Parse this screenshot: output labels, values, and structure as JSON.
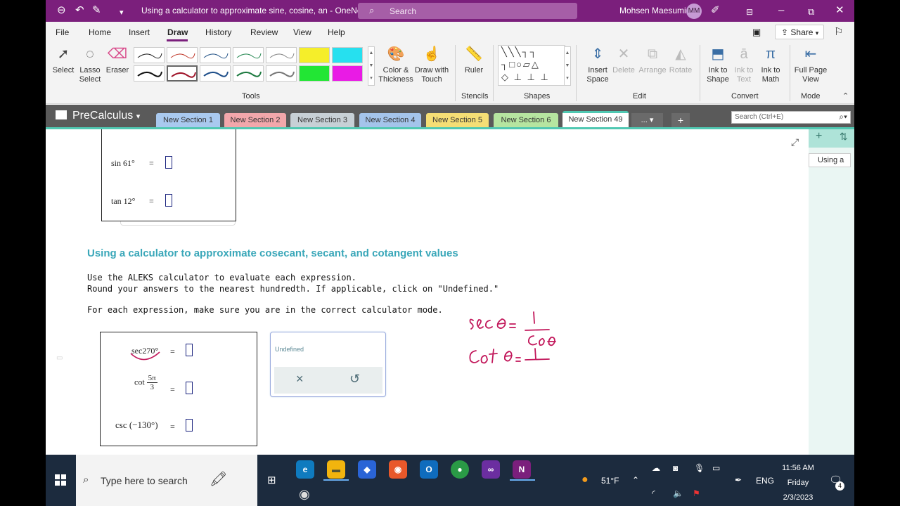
{
  "window": {
    "title": "Using a calculator to approximate sine, cosine, an  -  OneNote",
    "search_placeholder": "Search",
    "user_name": "Mohsen Maesumi",
    "user_initials": "MM"
  },
  "menu": {
    "tabs": [
      "File",
      "Home",
      "Insert",
      "Draw",
      "History",
      "Review",
      "View",
      "Help"
    ],
    "active": "Draw",
    "share_label": "Share"
  },
  "ribbon": {
    "select_label": "Select",
    "lasso_label": "Lasso Select",
    "eraser_label": "Eraser",
    "color_label": "Color & Thickness",
    "draw_touch_label": "Draw with Touch",
    "ruler_label": "Ruler",
    "insert_space_label": "Insert Space",
    "delete_label": "Delete",
    "arrange_label": "Arrange",
    "rotate_label": "Rotate",
    "ink_shape_label": "Ink to Shape",
    "ink_text_label": "Ink to Text",
    "ink_math_label": "Ink to Math",
    "full_page_label": "Full Page View",
    "groups": {
      "tools": "Tools",
      "stencils": "Stencils",
      "shapes": "Shapes",
      "edit": "Edit",
      "convert": "Convert",
      "mode": "Mode"
    },
    "pen_colors_row1": [
      "#222222",
      "#c0392b",
      "#2c5a8c",
      "#2a8a55",
      "#888888",
      "#f5ee2a",
      "#26e0ef"
    ],
    "pen_colors_row2": [
      "#111111",
      "#a0152a",
      "#1f4f8a",
      "#1d7a40",
      "#777777",
      "#22e634",
      "#e91be5"
    ]
  },
  "notebook": {
    "name": "PreCalculus",
    "search_placeholder": "Search (Ctrl+E)",
    "more_label": "...",
    "add_label": "+",
    "sections": [
      {
        "label": "New Section 1",
        "color": "#a9c9ef"
      },
      {
        "label": "New Section 2",
        "color": "#f2a7ab"
      },
      {
        "label": "New Section 3",
        "color": "#c7d0d6"
      },
      {
        "label": "New Section 4",
        "color": "#a4c4eb"
      },
      {
        "label": "New Section 5",
        "color": "#f5de75"
      },
      {
        "label": "New Section 6",
        "color": "#b6e5a0"
      },
      {
        "label": "New Section 49",
        "color": "#ffffff"
      }
    ],
    "active_section": "New Section 49",
    "page_tab": "Using a"
  },
  "page": {
    "prev_box": {
      "row1_func": "sin",
      "row1_arg": "61°",
      "row2_func": "tan",
      "row2_arg": "12°",
      "equals": "="
    },
    "heading": "Using a calculator to approximate cosecant, secant, and cotangent values",
    "instruction_line1": "Use the ALEKS calculator to evaluate each expression.",
    "instruction_line2": "Round your answers to the nearest hundredth. If applicable, click on \"Undefined.\"",
    "instruction_line3": "For each expression, make sure you are in the correct calculator mode.",
    "problems": {
      "p1": "sec270°",
      "p2_func": "cot",
      "p2_num": "5π",
      "p2_den": "3",
      "p3_func": "csc",
      "p3_arg": "(−130°)",
      "equals": "="
    },
    "undefined_panel": {
      "label": "Undefined",
      "clear_icon": "×",
      "undo_icon": "↺"
    },
    "handwriting_color": "#c2185b"
  },
  "taskbar": {
    "search_placeholder": "Type here to search",
    "weather": "51°F",
    "language": "ENG",
    "time": "11:56 AM",
    "day": "Friday",
    "date": "2/3/2023",
    "notification_count": "4"
  }
}
